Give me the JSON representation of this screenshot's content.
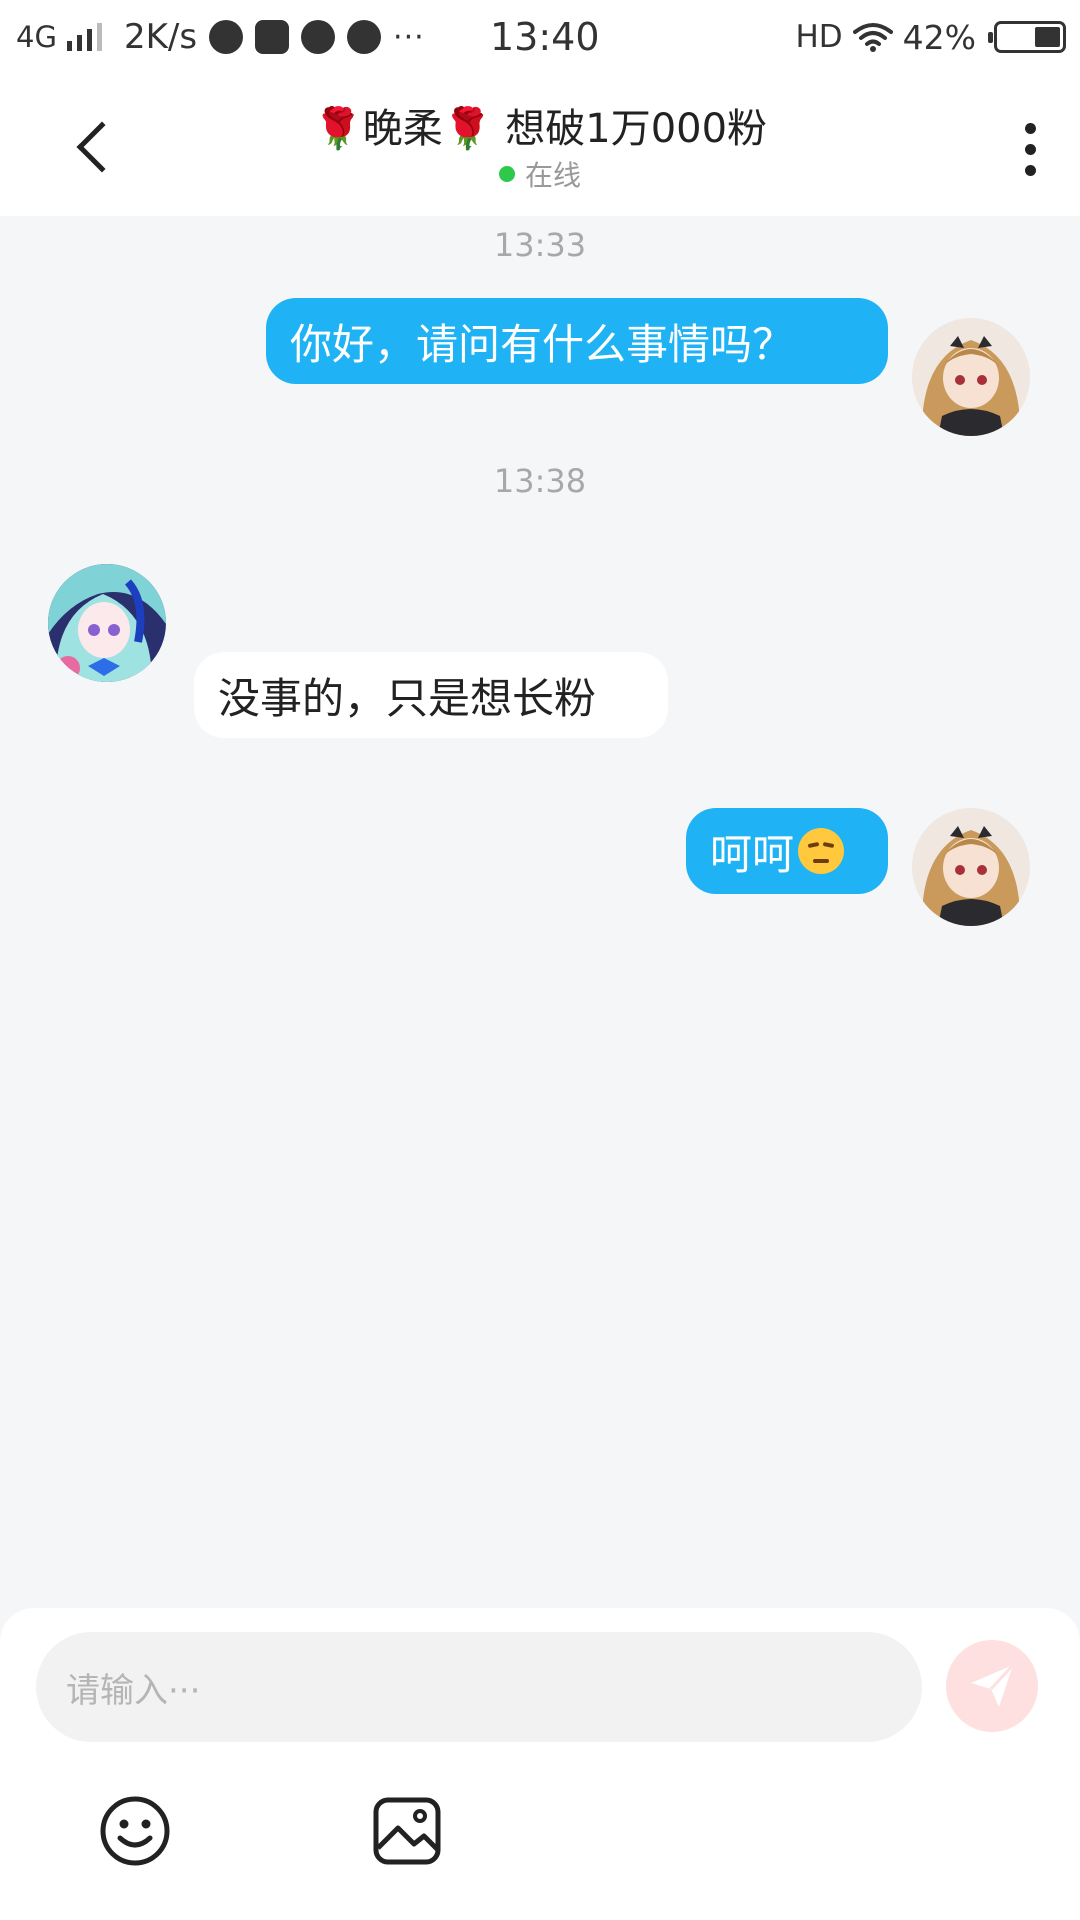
{
  "status_bar": {
    "network": "4G",
    "speed": "2K/s",
    "dots": "···",
    "time": "13:40",
    "hd": "HD",
    "battery_percent": "42%",
    "battery_level": 0.42
  },
  "header": {
    "title": "🌹晚柔🌹 想破1万000粉",
    "status": "在线",
    "back_icon": "chevron-left-icon",
    "more_icon": "more-vertical-icon"
  },
  "chat": {
    "messages": [
      {
        "time": "13:33",
        "direction": "outgoing",
        "text": "你好，请问有什么事情吗？"
      },
      {
        "time": "13:38",
        "direction": "incoming",
        "text": "没事的，只是想长粉"
      },
      {
        "direction": "outgoing",
        "text": "呵呵"
      }
    ]
  },
  "composer": {
    "placeholder": "请输入···",
    "send_icon": "send-icon",
    "emoji_icon": "emoji-icon",
    "image_icon": "image-icon"
  },
  "colors": {
    "outgoing_bubble": "#1fb3f5",
    "incoming_bubble": "#ffffff",
    "background": "#f5f6f8",
    "online": "#2ec94a",
    "send_button": "#fde0df"
  }
}
